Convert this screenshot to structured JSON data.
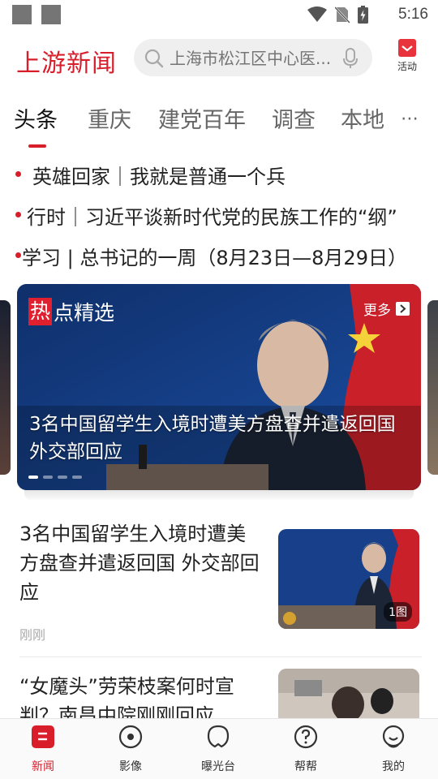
{
  "status_bar": {
    "time": "5:16"
  },
  "header": {
    "logo": "上游新闻",
    "search_placeholder": "上海市松江区中心医...",
    "activity_label": "活动"
  },
  "tabs": [
    "头条",
    "重庆",
    "建党百年",
    "调查",
    "本地"
  ],
  "tabs_more": "⋯",
  "headlines": [
    "英雄回家｜我就是普通一个兵",
    "行时｜习近平谈新时代党的民族工作的“纲”",
    "学习 | 总书记的一周（8月23日—8月29日）"
  ],
  "featured": {
    "section_hot": "热",
    "section_rest": "点精选",
    "more_label": "更多",
    "title": "3名中国留学生入境时遭美方盘查并遣返回国 外交部回应"
  },
  "news": [
    {
      "title": "3名中国留学生入境时遭美方盘查并遣返回国 外交部回应",
      "time": "刚刚",
      "badge": "1图"
    },
    {
      "title": "“女魔头”劳荣枝案何时宣判？南昌中院刚刚回应"
    }
  ],
  "bottom_nav": [
    "新闻",
    "影像",
    "曝光台",
    "帮帮",
    "我的"
  ],
  "colors": {
    "brand": "#d81e2b",
    "text": "#222222",
    "muted": "#aaaaaa"
  }
}
